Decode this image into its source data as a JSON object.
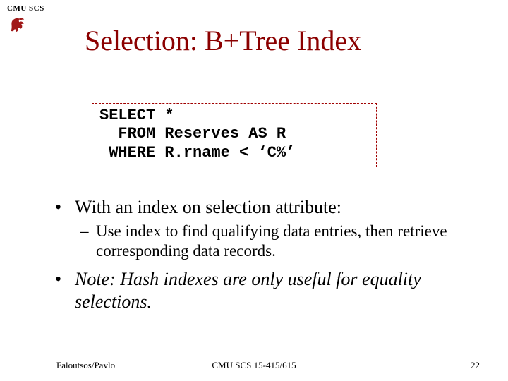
{
  "header": {
    "org_label": "CMU SCS"
  },
  "title": "Selection: B+Tree Index",
  "sql": {
    "line1_kw": "SELECT",
    "line1_rest": " *",
    "line2_kw": "  FROM",
    "line2_rest": " Reserves AS R",
    "line3_kw": " WHERE",
    "line3_rest": " R.rname < ‘C%’"
  },
  "bullets": {
    "b1": "With an index on selection attribute:",
    "b1_sub": "Use index to find qualifying data entries, then retrieve corresponding data records.",
    "b2": "Note: Hash indexes are only useful for equality selections."
  },
  "footer": {
    "left": "Faloutsos/Pavlo",
    "center": "CMU SCS 15-415/615",
    "right": "22"
  }
}
